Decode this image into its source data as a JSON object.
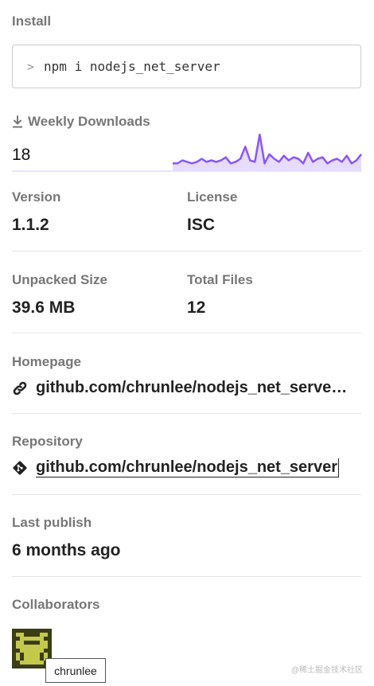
{
  "install": {
    "title": "Install",
    "prompt": ">",
    "command": "npm i nodejs_net_server"
  },
  "weekly_downloads": {
    "title": "Weekly Downloads",
    "count": "18",
    "icon": "download-icon",
    "line_color": "#8956ff",
    "fill_color": "#e6dcff",
    "trend": [
      3,
      3,
      5,
      4,
      3,
      4,
      6,
      4,
      5,
      4,
      5,
      7,
      3,
      4,
      6,
      14,
      5,
      4,
      22,
      3,
      9,
      6,
      4,
      8,
      5,
      7,
      6,
      3,
      10,
      4,
      6,
      7,
      3,
      5,
      6,
      4,
      8,
      3,
      5,
      9
    ]
  },
  "version": {
    "label": "Version",
    "value": "1.1.2"
  },
  "license": {
    "label": "License",
    "value": "ISC"
  },
  "unpacked_size": {
    "label": "Unpacked Size",
    "value": "39.6 MB"
  },
  "total_files": {
    "label": "Total Files",
    "value": "12"
  },
  "homepage": {
    "label": "Homepage",
    "link": "github.com/chrunlee/nodejs_net_serve…",
    "icon": "link-icon"
  },
  "repository": {
    "label": "Repository",
    "link": "github.com/chrunlee/nodejs_net_server",
    "icon": "git-icon"
  },
  "last_publish": {
    "label": "Last publish",
    "value": "6 months ago"
  },
  "collaborators": {
    "label": "Collaborators",
    "items": [
      {
        "name": "chrunlee",
        "avatar_bg": "#3b3d14",
        "avatar_fg": "#c4c94a"
      }
    ],
    "tooltip": "chrunlee"
  },
  "watermark": "@稀土掘金技术社区"
}
